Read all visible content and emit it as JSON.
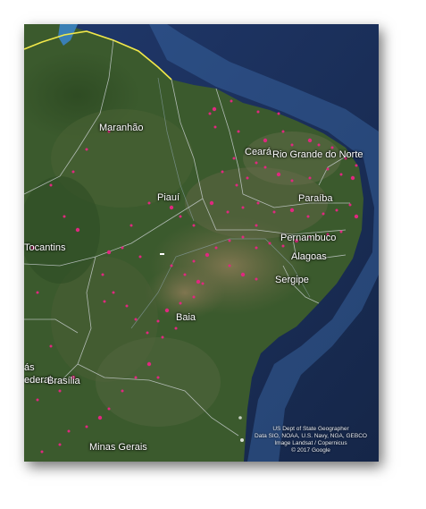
{
  "map": {
    "labels": {
      "maranhao": "Maranhão",
      "ceara": "Ceará",
      "rio_grande_do_norte": "Rio Grande do Norte",
      "piaui": "Piauí",
      "paraiba": "Paraíba",
      "tocantins": "Tocantins",
      "pernambuco": "Pernambuco",
      "alagoas": "Alagoas",
      "sergipe": "Sergipe",
      "baia": "Baia",
      "brasilia": "Brasília",
      "federal": "ederal",
      "as": "ás",
      "minas_gerais": "Minas Gerais"
    },
    "attribution": [
      "US Dept of State Geographer",
      "Data SIO, NOAA, U.S. Navy, NGA, GEBCO",
      "Image Landsat / Copernicus",
      "© 2017 Google"
    ],
    "colors": {
      "ocean": "#1b2f55",
      "land": "#3c5a2e",
      "marker": "#e0287f",
      "border": "#d7dbe0",
      "coast_highlight": "#f1e84a"
    },
    "marker_icon": "pink-dot-marker"
  }
}
